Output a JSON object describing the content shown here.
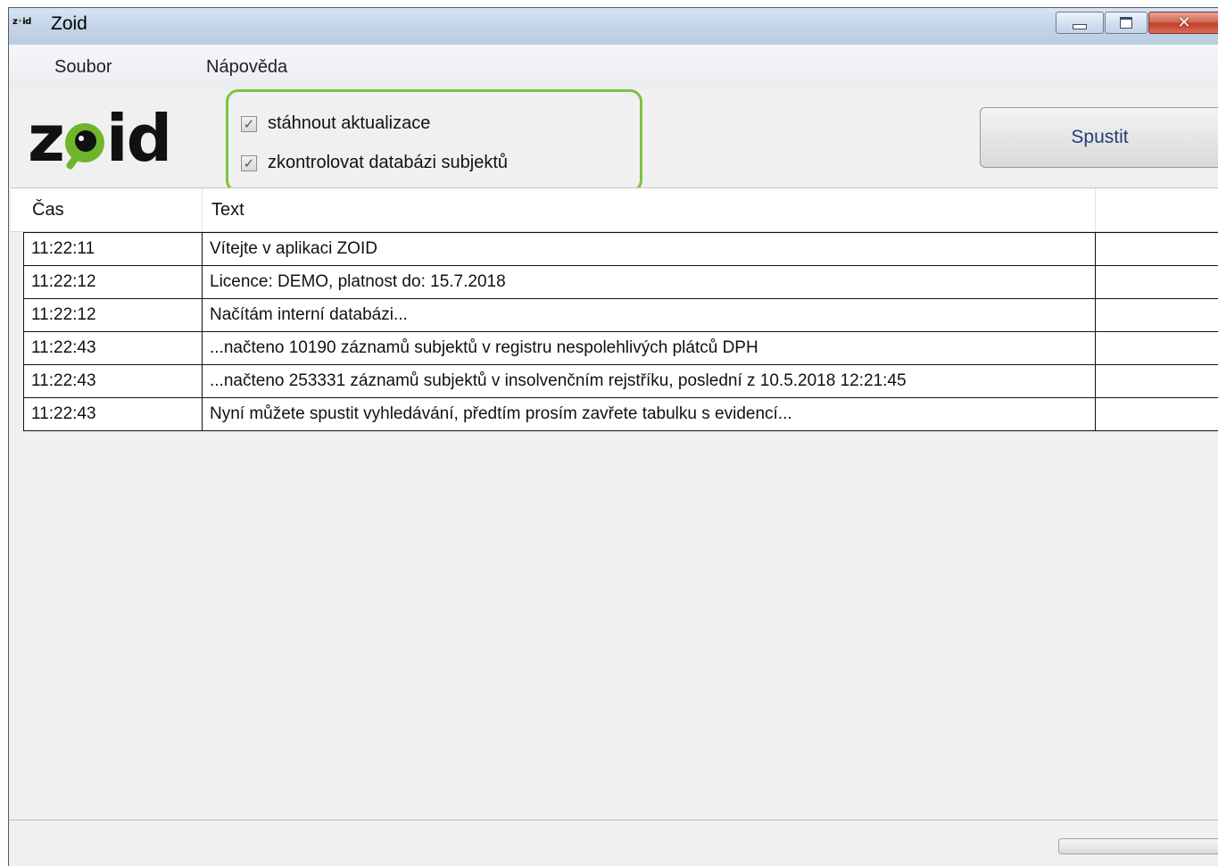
{
  "window": {
    "title_logo_left": "z",
    "title_logo_mid": "•",
    "title_logo_right": "id",
    "title": "Zoid",
    "buttons": {
      "minimize": "minimize-icon",
      "maximize": "maximize-icon",
      "close": "close-icon"
    }
  },
  "menu": {
    "items": [
      "Soubor",
      "Nápověda"
    ]
  },
  "logo": {
    "left": "z",
    "right": "id"
  },
  "options": {
    "download_updates": {
      "label": "stáhnout aktualizace",
      "checked": true
    },
    "check_database": {
      "label": "zkontrolovat databázi subjektů",
      "checked": true
    }
  },
  "run_button": {
    "label": "Spustit"
  },
  "log": {
    "columns": [
      "Čas",
      "Text"
    ],
    "rows": [
      {
        "time": "11:22:11",
        "text": "Vítejte v aplikaci ZOID"
      },
      {
        "time": "11:22:12",
        "text": "Licence: DEMO, platnost do: 15.7.2018"
      },
      {
        "time": "11:22:12",
        "text": "Načítám interní databázi..."
      },
      {
        "time": "11:22:43",
        "text": "...načteno 10190 záznamů subjektů v registru nespolehlivých plátců DPH"
      },
      {
        "time": "11:22:43",
        "text": "...načteno 253331 záznamů subjektů v insolvenčním rejstříku, poslední z 10.5.2018 12:21:45"
      },
      {
        "time": "11:22:43",
        "text": "Nyní můžete spustit vyhledávání, předtím prosím zavřete tabulku s evidencí..."
      }
    ]
  },
  "colors": {
    "accent_green": "#7dc242",
    "logo_green": "#6fb52c",
    "button_text": "#1f3f7a"
  }
}
